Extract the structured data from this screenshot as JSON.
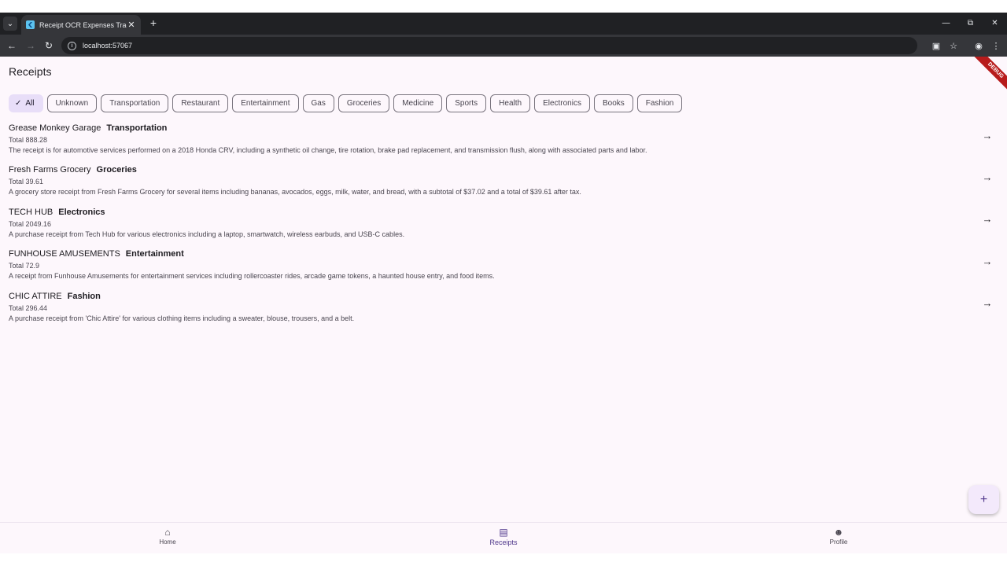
{
  "browser": {
    "tab_title": "Receipt OCR Expenses Tracker",
    "url": "localhost:57067"
  },
  "app": {
    "title": "Receipts",
    "debug_label": "DEBUG",
    "filters": [
      {
        "label": "All",
        "selected": true
      },
      {
        "label": "Unknown",
        "selected": false
      },
      {
        "label": "Transportation",
        "selected": false
      },
      {
        "label": "Restaurant",
        "selected": false
      },
      {
        "label": "Entertainment",
        "selected": false
      },
      {
        "label": "Gas",
        "selected": false
      },
      {
        "label": "Groceries",
        "selected": false
      },
      {
        "label": "Medicine",
        "selected": false
      },
      {
        "label": "Sports",
        "selected": false
      },
      {
        "label": "Health",
        "selected": false
      },
      {
        "label": "Electronics",
        "selected": false
      },
      {
        "label": "Books",
        "selected": false
      },
      {
        "label": "Fashion",
        "selected": false
      }
    ],
    "receipts": [
      {
        "merchant": "Grease Monkey Garage",
        "category": "Transportation",
        "total": "Total 888.28",
        "description": "The receipt is for automotive services performed on a 2018 Honda CRV, including a synthetic oil change, tire rotation, brake pad replacement, and transmission flush, along with associated parts and labor."
      },
      {
        "merchant": "Fresh Farms Grocery",
        "category": "Groceries",
        "total": "Total 39.61",
        "description": "A grocery store receipt from Fresh Farms Grocery for several items including bananas, avocados, eggs, milk, water, and bread, with a subtotal of $37.02 and a total of $39.61 after tax."
      },
      {
        "merchant": "TECH HUB",
        "category": "Electronics",
        "total": "Total 2049.16",
        "description": "A purchase receipt from Tech Hub for various electronics including a laptop, smartwatch, wireless earbuds, and USB-C cables."
      },
      {
        "merchant": "FUNHOUSE AMUSEMENTS",
        "category": "Entertainment",
        "total": "Total 72.9",
        "description": "A receipt from Funhouse Amusements for entertainment services including rollercoaster rides, arcade game tokens, a haunted house entry, and food items."
      },
      {
        "merchant": "CHIC ATTIRE",
        "category": "Fashion",
        "total": "Total 296.44",
        "description": "A purchase receipt from 'Chic Attire' for various clothing items including a sweater, blouse, trousers, and a belt."
      }
    ],
    "fab_icon": "plus-icon",
    "bottom_nav": [
      {
        "label": "Home",
        "icon": "home-icon",
        "active": false
      },
      {
        "label": "Receipts",
        "icon": "receipt-icon",
        "active": true
      },
      {
        "label": "Profile",
        "icon": "person-icon",
        "active": false
      }
    ]
  },
  "colors": {
    "accent": "#4f378b",
    "selected_chip": "#e8def8",
    "app_background": "#fdf7fc"
  }
}
